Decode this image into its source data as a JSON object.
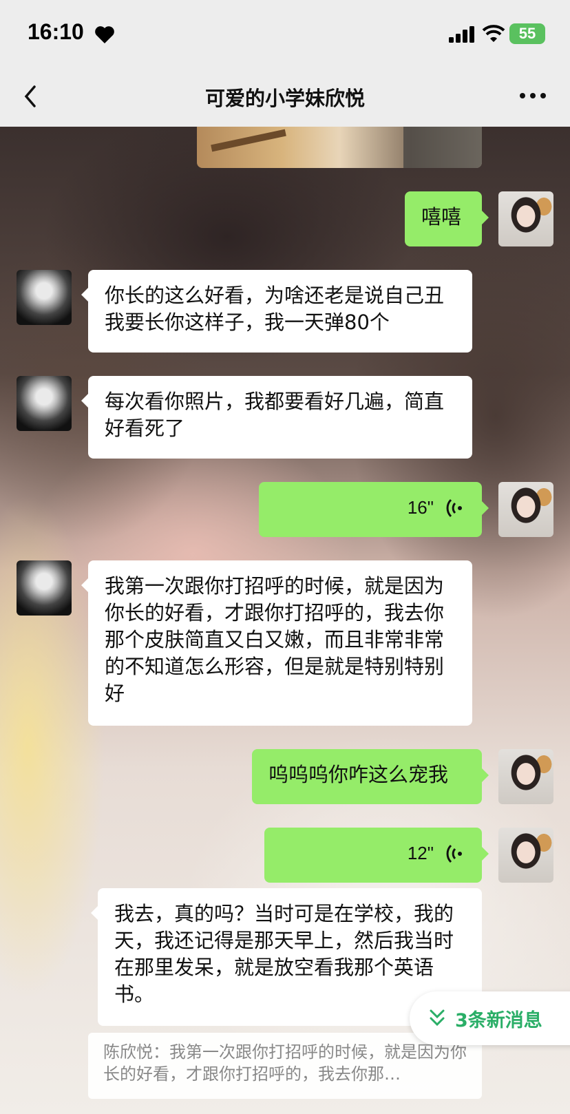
{
  "status": {
    "time": "16:10",
    "battery": "55"
  },
  "nav": {
    "title": "可爱的小学妹欣悦"
  },
  "messages": {
    "m1": "嘻嘻",
    "m2": "你长的这么好看，为啥还老是说自己丑我要长你这样子，我一天弹80个",
    "m3": "每次看你照片，我都要看好几遍，简直好看死了",
    "m4": "16\"",
    "m5": "我第一次跟你打招呼的时候，就是因为你长的好看，才跟你打招呼的，我去你那个皮肤简直又白又嫩，而且非常非常的不知道怎么形容，但是就是特别特别好",
    "m6": "呜呜呜你咋这么宠我",
    "m7": "12\"",
    "m8": "我去，真的吗？当时可是在学校，我的天，我还记得是那天早上，然后我当时在那里发呆，就是放空看我那个英语书。"
  },
  "quote": {
    "text": "陈欣悦：我第一次跟你打招呼的时候，就是因为你长的好看，才跟你打招呼的，我去你那…"
  },
  "new_messages": {
    "label": "3条新消息"
  },
  "colors": {
    "outgoing_bubble": "#95ec69",
    "incoming_bubble": "#ffffff",
    "accent": "#2aae67"
  },
  "icons": [
    "heart-icon",
    "signal-icon",
    "wifi-icon",
    "back-icon",
    "more-icon",
    "voice-icon",
    "double-chevron-down-icon"
  ]
}
